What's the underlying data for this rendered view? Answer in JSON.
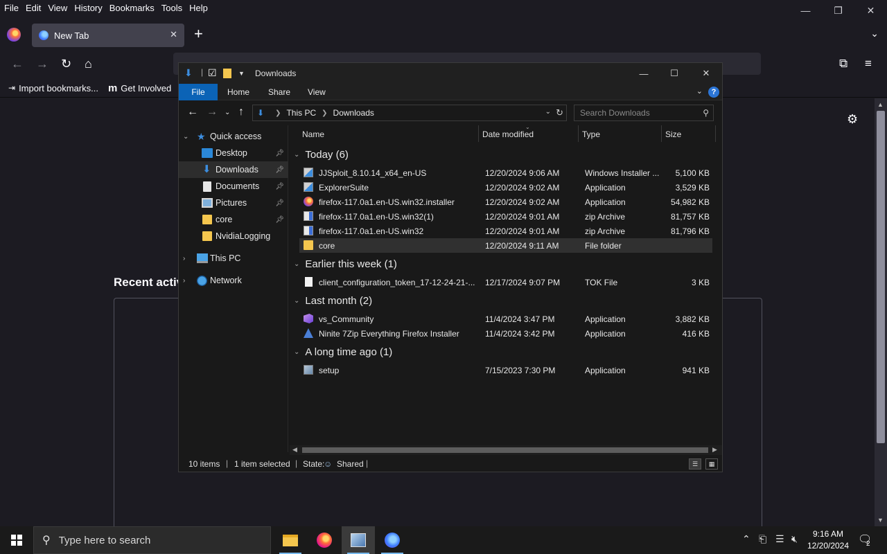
{
  "firefox": {
    "menu": [
      "File",
      "Edit",
      "View",
      "History",
      "Bookmarks",
      "Tools",
      "Help"
    ],
    "tab_title": "New Tab",
    "bookmarks": [
      {
        "label": "Import bookmarks...",
        "icon": "import-icon"
      },
      {
        "label": "Get Involved",
        "icon": "mozilla-m-icon"
      }
    ],
    "recent_activity_heading": "Recent activ"
  },
  "explorer": {
    "title": "Downloads",
    "ribbon_tabs": [
      "File",
      "Home",
      "Share",
      "View"
    ],
    "breadcrumb": [
      "This PC",
      "Downloads"
    ],
    "search_placeholder": "Search Downloads",
    "nav_pane": {
      "quick_access": "Quick access",
      "items": [
        {
          "label": "Desktop",
          "icon": "desktop-icon",
          "pinned": true
        },
        {
          "label": "Downloads",
          "icon": "downloads-icon",
          "pinned": true,
          "selected": true
        },
        {
          "label": "Documents",
          "icon": "documents-icon",
          "pinned": true
        },
        {
          "label": "Pictures",
          "icon": "pictures-icon",
          "pinned": true
        },
        {
          "label": "core",
          "icon": "folder-icon",
          "pinned": true
        },
        {
          "label": "NvidiaLogging",
          "icon": "folder-icon",
          "pinned": false
        }
      ],
      "this_pc": "This PC",
      "network": "Network"
    },
    "columns": {
      "name": "Name",
      "date": "Date modified",
      "type": "Type",
      "size": "Size"
    },
    "groups": [
      {
        "title": "Today (6)",
        "rows": [
          {
            "name": "JJSploit_8.10.14_x64_en-US",
            "date": "12/20/2024 9:06 AM",
            "type": "Windows Installer ...",
            "size": "5,100 KB",
            "icon": "installer-icon"
          },
          {
            "name": "ExplorerSuite",
            "date": "12/20/2024 9:02 AM",
            "type": "Application",
            "size": "3,529 KB",
            "icon": "installer-icon"
          },
          {
            "name": "firefox-117.0a1.en-US.win32.installer",
            "date": "12/20/2024 9:02 AM",
            "type": "Application",
            "size": "54,982 KB",
            "icon": "firefox-icon"
          },
          {
            "name": "firefox-117.0a1.en-US.win32(1)",
            "date": "12/20/2024 9:01 AM",
            "type": "zip Archive",
            "size": "81,757 KB",
            "icon": "zip-icon"
          },
          {
            "name": "firefox-117.0a1.en-US.win32",
            "date": "12/20/2024 9:01 AM",
            "type": "zip Archive",
            "size": "81,796 KB",
            "icon": "zip-icon"
          },
          {
            "name": "core",
            "date": "12/20/2024 9:11 AM",
            "type": "File folder",
            "size": "",
            "icon": "folder-icon",
            "selected": true
          }
        ]
      },
      {
        "title": "Earlier this week (1)",
        "rows": [
          {
            "name": "client_configuration_token_17-12-24-21-...",
            "date": "12/17/2024 9:07 PM",
            "type": "TOK File",
            "size": "3 KB",
            "icon": "file-icon"
          }
        ]
      },
      {
        "title": "Last month (2)",
        "rows": [
          {
            "name": "vs_Community",
            "date": "11/4/2024 3:47 PM",
            "type": "Application",
            "size": "3,882 KB",
            "icon": "visual-studio-icon"
          },
          {
            "name": "Ninite 7Zip Everything Firefox Installer",
            "date": "11/4/2024 3:42 PM",
            "type": "Application",
            "size": "416 KB",
            "icon": "ninite-icon"
          }
        ]
      },
      {
        "title": "A long time ago (1)",
        "rows": [
          {
            "name": "setup",
            "date": "7/15/2023 7:30 PM",
            "type": "Application",
            "size": "941 KB",
            "icon": "setup-icon"
          }
        ]
      }
    ],
    "status": {
      "items": "10 items",
      "selected": "1 item selected",
      "state_label": "State:",
      "state_value": "Shared"
    }
  },
  "taskbar": {
    "search_placeholder": "Type here to search",
    "time": "9:16 AM",
    "date": "12/20/2024",
    "notification_count": "2"
  }
}
